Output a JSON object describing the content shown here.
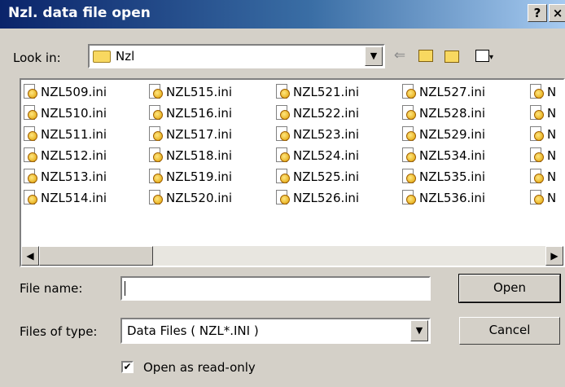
{
  "window": {
    "title": "Nzl. data file open",
    "help_label": "?",
    "close_label": "×"
  },
  "look_in": {
    "label": "Look in:",
    "value": "Nzl"
  },
  "toolbar": {
    "back_icon": "back-arrow-icon",
    "up_icon": "up-folder-icon",
    "new_folder_icon": "new-folder-icon",
    "views_icon": "views-menu-icon"
  },
  "files": [
    [
      "NZL509.ini",
      "NZL510.ini",
      "NZL511.ini",
      "NZL512.ini",
      "NZL513.ini",
      "NZL514.ini"
    ],
    [
      "NZL515.ini",
      "NZL516.ini",
      "NZL517.ini",
      "NZL518.ini",
      "NZL519.ini",
      "NZL520.ini"
    ],
    [
      "NZL521.ini",
      "NZL522.ini",
      "NZL523.ini",
      "NZL524.ini",
      "NZL525.ini",
      "NZL526.ini"
    ],
    [
      "NZL527.ini",
      "NZL528.ini",
      "NZL529.ini",
      "NZL534.ini",
      "NZL535.ini",
      "NZL536.ini"
    ],
    [
      "N",
      "N",
      "N",
      "N",
      "N",
      "N"
    ]
  ],
  "file_name": {
    "label": "File name:",
    "value": ""
  },
  "file_type": {
    "label": "Files of type:",
    "value": "Data Files ( NZL*.INI )"
  },
  "buttons": {
    "open": "Open",
    "cancel": "Cancel"
  },
  "readonly": {
    "label": "Open as read-only",
    "checked": true,
    "mark": "✔"
  },
  "scroll": {
    "left": "◀",
    "right": "▶"
  }
}
